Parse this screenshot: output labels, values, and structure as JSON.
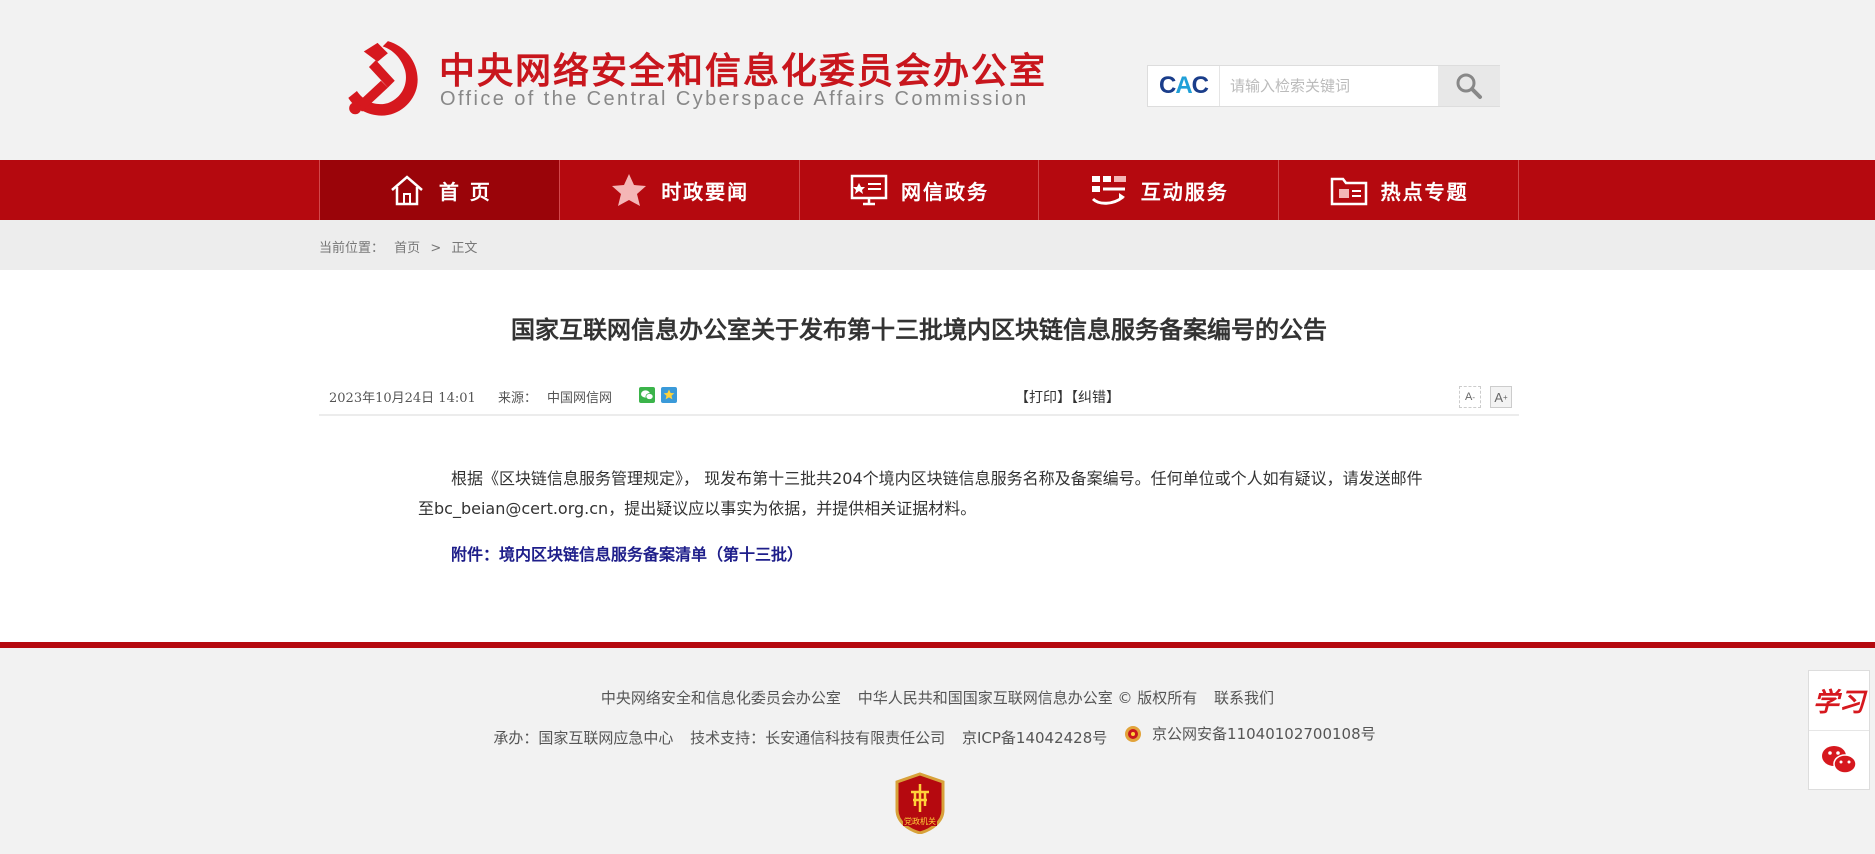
{
  "header": {
    "title_cn": "中央网络安全和信息化委员会办公室",
    "title_en": "Office of the Central Cyberspace Affairs Commission",
    "search": {
      "logo_text_left": "C",
      "logo_text_mid": "A",
      "logo_text_right": "C",
      "placeholder": "请输入检索关键词"
    }
  },
  "nav": {
    "items": [
      {
        "label": "首 页",
        "icon": "home-icon",
        "active": true
      },
      {
        "label": "时政要闻",
        "icon": "star-icon",
        "active": false
      },
      {
        "label": "网信政务",
        "icon": "monitor-icon",
        "active": false
      },
      {
        "label": "互动服务",
        "icon": "interaction-icon",
        "active": false
      },
      {
        "label": "热点专题",
        "icon": "folder-icon",
        "active": false
      }
    ]
  },
  "breadcrumb": {
    "label": "当前位置：",
    "home": "首页",
    "separator": ">",
    "current": "正文"
  },
  "article": {
    "title": "国家互联网信息办公室关于发布第十三批境内区块链信息服务备案编号的公告",
    "date": "2023年10月24日 14:01",
    "source_label": "来源：",
    "source": "中国网信网",
    "print_label": "【打印】",
    "correct_label": "【纠错】",
    "font_small": "A",
    "font_large": "A",
    "body": "根据《区块链信息服务管理规定》， 现发布第十三批共204个境内区块链信息服务名称及备案编号。任何单位或个人如有疑议，请发送邮件至bc_beian@cert.org.cn，提出疑议应以事实为依据，并提供相关证据材料。",
    "attachment": "附件：境内区块链信息服务备案清单（第十三批）"
  },
  "footer": {
    "org1": "中央网络安全和信息化委员会办公室",
    "org2": "中华人民共和国国家互联网信息办公室 © 版权所有",
    "contact": "联系我们",
    "host": "承办：国家互联网应急中心",
    "tech": "技术支持：长安通信科技有限责任公司",
    "icp": "京ICP备14042428号",
    "police": "京公网安备11040102700108号",
    "badge_text": "党政机关"
  },
  "side": {
    "xuexi": "学习"
  },
  "colors": {
    "brand_red": "#c8161d",
    "nav_red": "#b5090f",
    "nav_active": "#9a0409",
    "attachment_blue": "#1e1e8a"
  }
}
